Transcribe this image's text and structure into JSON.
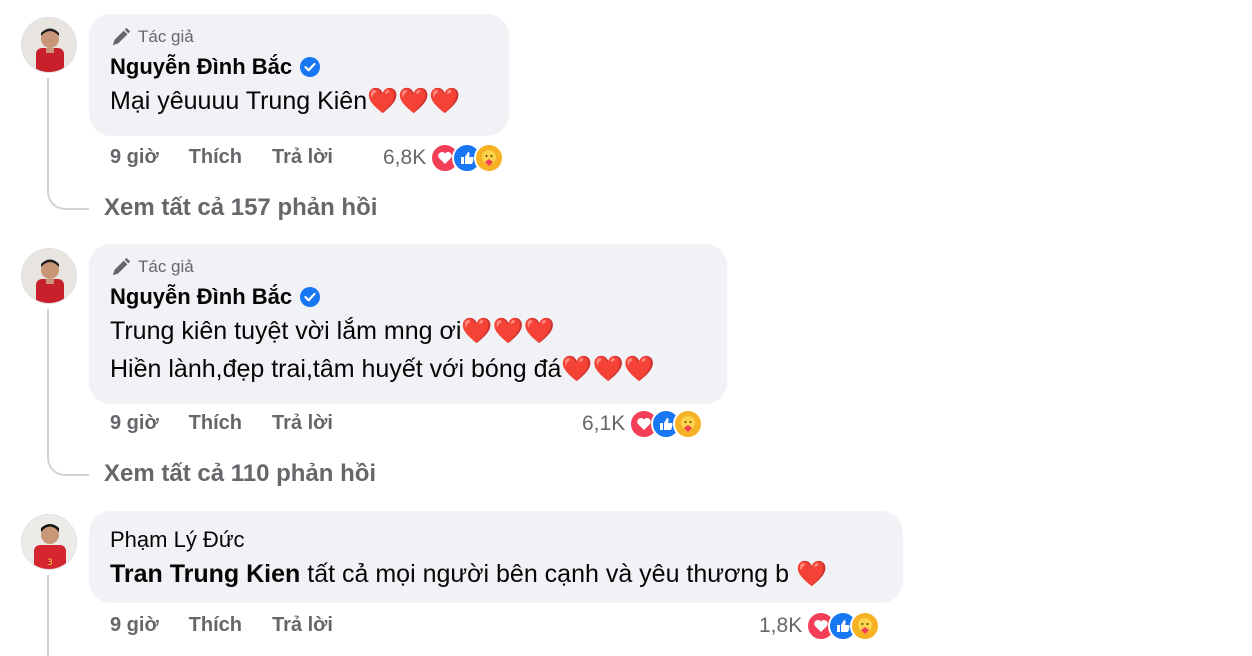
{
  "comments": [
    {
      "author_badge": "Tác giả",
      "author": "Nguyễn Đình Bắc",
      "lines": [
        "Mại yêuuuu Trung Kiên❤️❤️❤️"
      ],
      "time": "9 giờ",
      "like": "Thích",
      "reply": "Trả lời",
      "reaction_count": "6,8K",
      "replies_link": "Xem tất cả 157 phản hồi"
    },
    {
      "author_badge": "Tác giả",
      "author": "Nguyễn Đình Bắc",
      "lines": [
        "Trung kiên tuyệt vời lắm mng ơi❤️❤️❤️",
        "Hiền lành,đẹp trai,tâm huyết với bóng đá❤️❤️❤️"
      ],
      "time": "9 giờ",
      "like": "Thích",
      "reply": "Trả lời",
      "reaction_count": "6,1K",
      "replies_link": "Xem tất cả 110 phản hồi"
    },
    {
      "author": "Phạm Lý Đức",
      "mention": "Tran Trung Kien",
      "text": "tất cả mọi người bên cạnh và yêu thương b ❤️",
      "time": "9 giờ",
      "like": "Thích",
      "reply": "Trả lời",
      "reaction_count": "1,8K"
    }
  ],
  "colors": {
    "bubble": "#f0f2f5",
    "secondary_text": "#65676b",
    "verified": "#1877f2",
    "love": "#f33e58",
    "like": "#1877f2",
    "care": "#f7b125"
  },
  "icons": [
    "pen-icon",
    "verified-badge-icon",
    "love-reaction-icon",
    "like-reaction-icon",
    "care-reaction-icon"
  ]
}
